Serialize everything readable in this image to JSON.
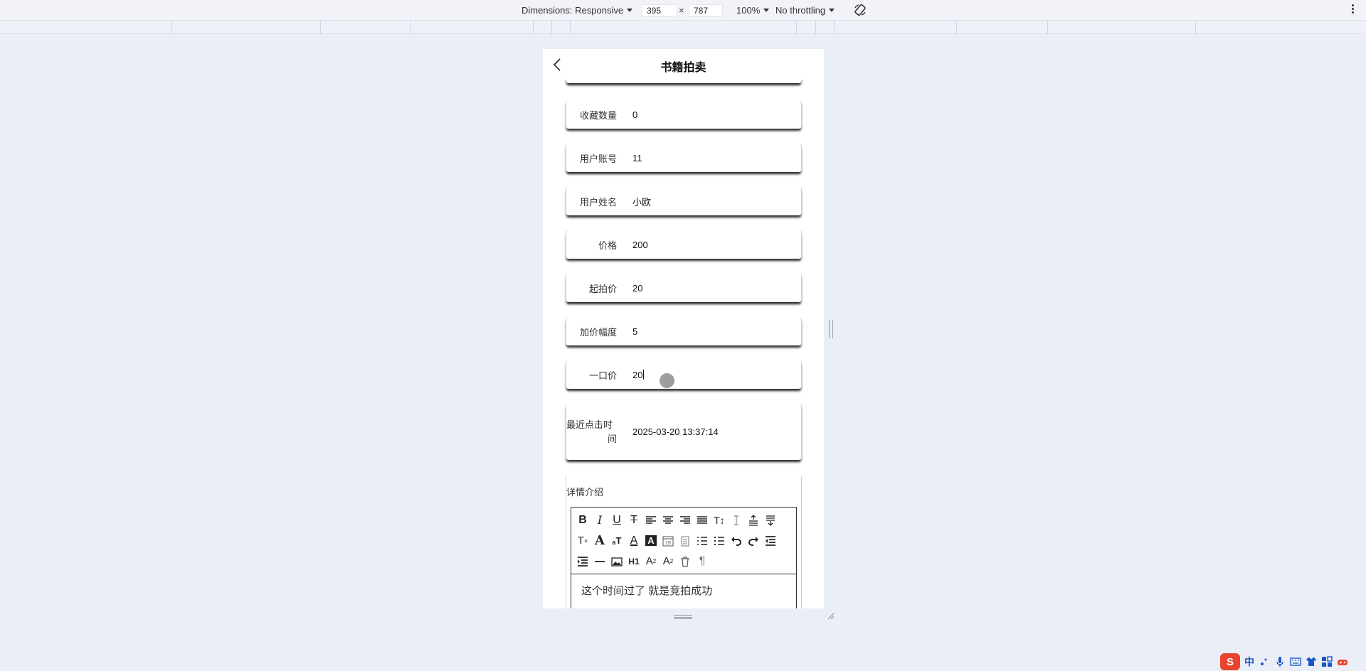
{
  "devtools": {
    "dimensions_label": "Dimensions: Responsive",
    "width": "395",
    "times": "×",
    "height": "787",
    "zoom": "100%",
    "throttling": "No throttling"
  },
  "app": {
    "title": "书籍拍卖",
    "fields": [
      {
        "label": "收藏数量",
        "value": "0"
      },
      {
        "label": "用户账号",
        "value": "11"
      },
      {
        "label": "用户姓名",
        "value": "小欧"
      },
      {
        "label": "价格",
        "value": "200"
      },
      {
        "label": "起拍价",
        "value": "20"
      },
      {
        "label": "加价幅度",
        "value": "5"
      },
      {
        "label": "一口价",
        "value": "20"
      }
    ],
    "recent_click": {
      "label_line1": "最近点击时",
      "label_line2": "间",
      "value": "2025-03-20 13:37:14"
    },
    "detail": {
      "label": "详情介绍",
      "content": "这个时间过了 就是竞拍成功",
      "toolbar_text": {
        "h1": "H1",
        "sub": "A",
        "sup": "A"
      }
    }
  },
  "ime": {
    "mode": "中"
  }
}
